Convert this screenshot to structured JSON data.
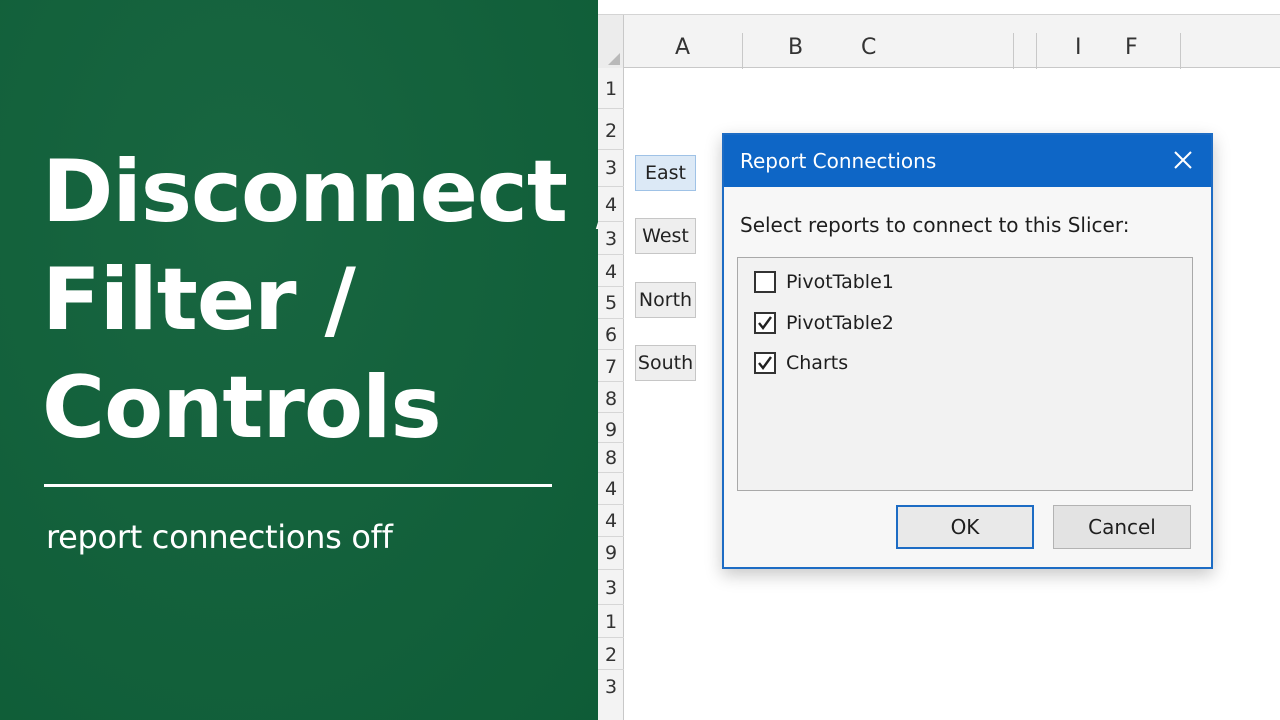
{
  "left_panel": {
    "headline_lines": [
      "Disconnect /",
      "Filter /",
      "Controls"
    ],
    "subtitle": "report connections off",
    "background_color": "#0f6039"
  },
  "sheet": {
    "column_letters": [
      "A",
      "B",
      "C",
      "I",
      "F"
    ],
    "row_numbers": [
      "1",
      "2",
      "3",
      "4",
      "3",
      "4",
      "5",
      "6",
      "7",
      "8",
      "9",
      "8",
      "4",
      "4",
      "9",
      "3",
      "1",
      "2",
      "3"
    ],
    "slicer_items": [
      {
        "label": "East",
        "selected": true
      },
      {
        "label": "West",
        "selected": false
      },
      {
        "label": "North",
        "selected": false
      },
      {
        "label": "South",
        "selected": false
      }
    ]
  },
  "dialog": {
    "title": "Report Connections",
    "close_icon": "close-icon",
    "prompt": "Select reports to connect to this Slicer:",
    "items": [
      {
        "label": "PivotTable1",
        "checked": false
      },
      {
        "label": "PivotTable2",
        "checked": true
      },
      {
        "label": "Charts",
        "checked": true
      }
    ],
    "ok_label": "OK",
    "cancel_label": "Cancel",
    "accent_color": "#0e66c6"
  }
}
